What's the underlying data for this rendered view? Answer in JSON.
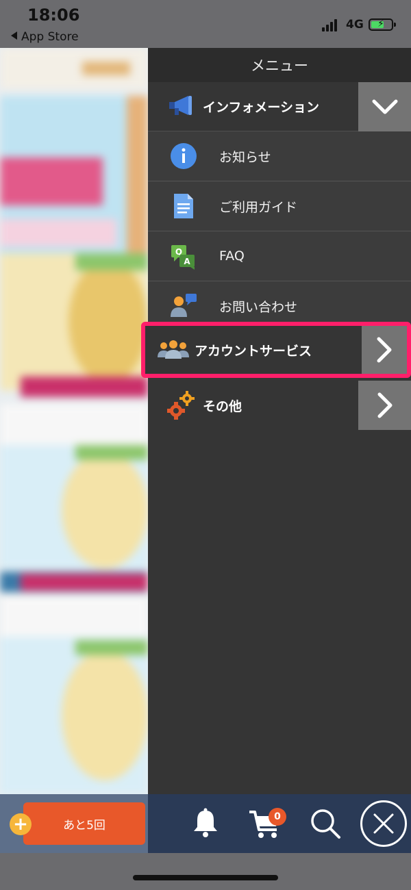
{
  "status_bar": {
    "time": "18:06",
    "back_label": "App Store",
    "network": "4G",
    "battery_color": "#4cd964"
  },
  "menu": {
    "title": "メニュー",
    "sections": [
      {
        "id": "information",
        "label": "インフォメーション",
        "icon": "megaphone-icon",
        "toggle": "chevron-down-icon",
        "items": [
          {
            "label": "お知らせ",
            "icon": "info-icon"
          },
          {
            "label": "ご利用ガイド",
            "icon": "document-icon"
          },
          {
            "label": "FAQ",
            "icon": "faq-icon"
          },
          {
            "label": "お問い合わせ",
            "icon": "contact-icon"
          }
        ]
      },
      {
        "id": "account",
        "label": "アカウントサービス",
        "icon": "users-icon",
        "toggle": "chevron-right-icon",
        "highlighted": true,
        "highlight_color": "#ff1f6a"
      },
      {
        "id": "other",
        "label": "その他",
        "icon": "gears-icon",
        "toggle": "chevron-right-icon"
      }
    ]
  },
  "bottom_bar": {
    "remaining_label": "あと5回",
    "cart_count": "0",
    "icons": [
      "bell-icon",
      "cart-icon",
      "search-icon",
      "close-icon"
    ],
    "accent": "#e8582a"
  }
}
